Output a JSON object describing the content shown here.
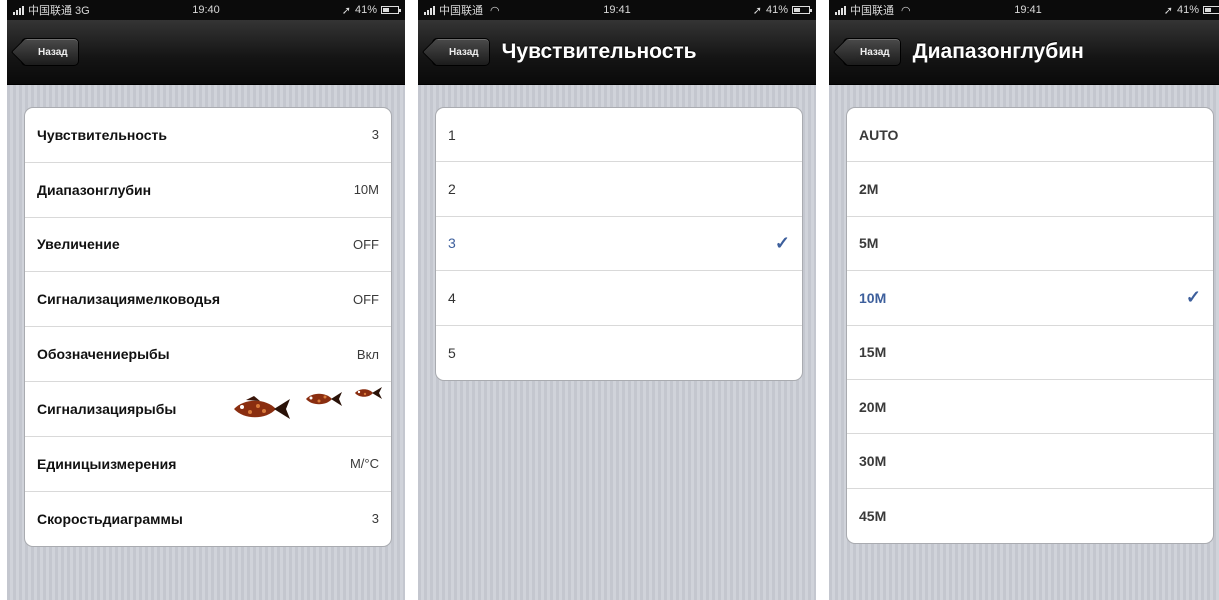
{
  "screens": [
    {
      "status": {
        "carrier": "中国联通 3G",
        "time": "19:40",
        "battery": "41%"
      },
      "nav": {
        "back_label": "Назад",
        "title": ""
      },
      "settings": [
        {
          "label": "Чувствительность",
          "value": "3"
        },
        {
          "label": "Диапазонглубин",
          "value": "10M"
        },
        {
          "label": "Увеличение",
          "value": "OFF"
        },
        {
          "label": "Сигнализациямелководья",
          "value": "OFF"
        },
        {
          "label": "Обозначениерыбы",
          "value": "Вкл"
        },
        {
          "label": "Сигнализациярыбы",
          "value": ""
        },
        {
          "label": "Единицыизмерения",
          "value": "M/°C"
        },
        {
          "label": "Скоростьдиаграммы",
          "value": "3"
        }
      ]
    },
    {
      "status": {
        "carrier": "中国联通",
        "time": "19:41",
        "battery": "41%"
      },
      "nav": {
        "back_label": "Назад",
        "title": "Чувствительность"
      },
      "options": [
        "1",
        "2",
        "3",
        "4",
        "5"
      ],
      "selected": "3"
    },
    {
      "status": {
        "carrier": "中国联通",
        "time": "19:41",
        "battery": "41%"
      },
      "nav": {
        "back_label": "Назад",
        "title": "Диапазонглубин"
      },
      "options": [
        "AUTO",
        "2M",
        "5M",
        "10M",
        "15M",
        "20M",
        "30M",
        "45M"
      ],
      "selected": "10M"
    }
  ],
  "icons": {
    "checkmark": "✓",
    "fish_alarm": "fish-icon"
  },
  "colors": {
    "accent": "#3d5f9c",
    "navbar": "#141414",
    "background": "#c9ccd3"
  }
}
